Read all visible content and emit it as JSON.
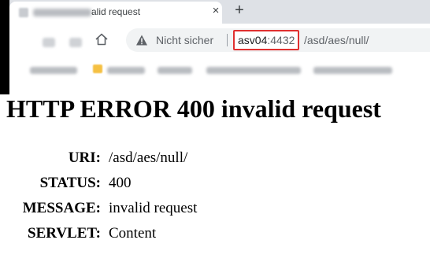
{
  "browser": {
    "tab": {
      "title": "alid request",
      "close_glyph": "×",
      "favicon_icon": "page-favicon-icon"
    },
    "new_tab_glyph": "+",
    "toolbar": {
      "back_icon": "back-arrow-icon",
      "reload_icon": "reload-icon",
      "home_icon": "home-icon",
      "security_icon": "warning-triangle-icon",
      "security_label": "Nicht sicher",
      "url_host": "asv04",
      "url_port": ":4432",
      "url_path": "/asd/aes/null/"
    },
    "colors": {
      "tab_strip": "#dee1e6",
      "omnibox": "#f1f3f4",
      "highlight_border": "#e03030",
      "redaction": "#000000"
    }
  },
  "page": {
    "heading": "HTTP ERROR 400 invalid request",
    "details": [
      {
        "label": "URI:",
        "value": "/asd/aes/null/"
      },
      {
        "label": "STATUS:",
        "value": "400"
      },
      {
        "label": "MESSAGE:",
        "value": "invalid request"
      },
      {
        "label": "SERVLET:",
        "value": "Content"
      }
    ]
  }
}
